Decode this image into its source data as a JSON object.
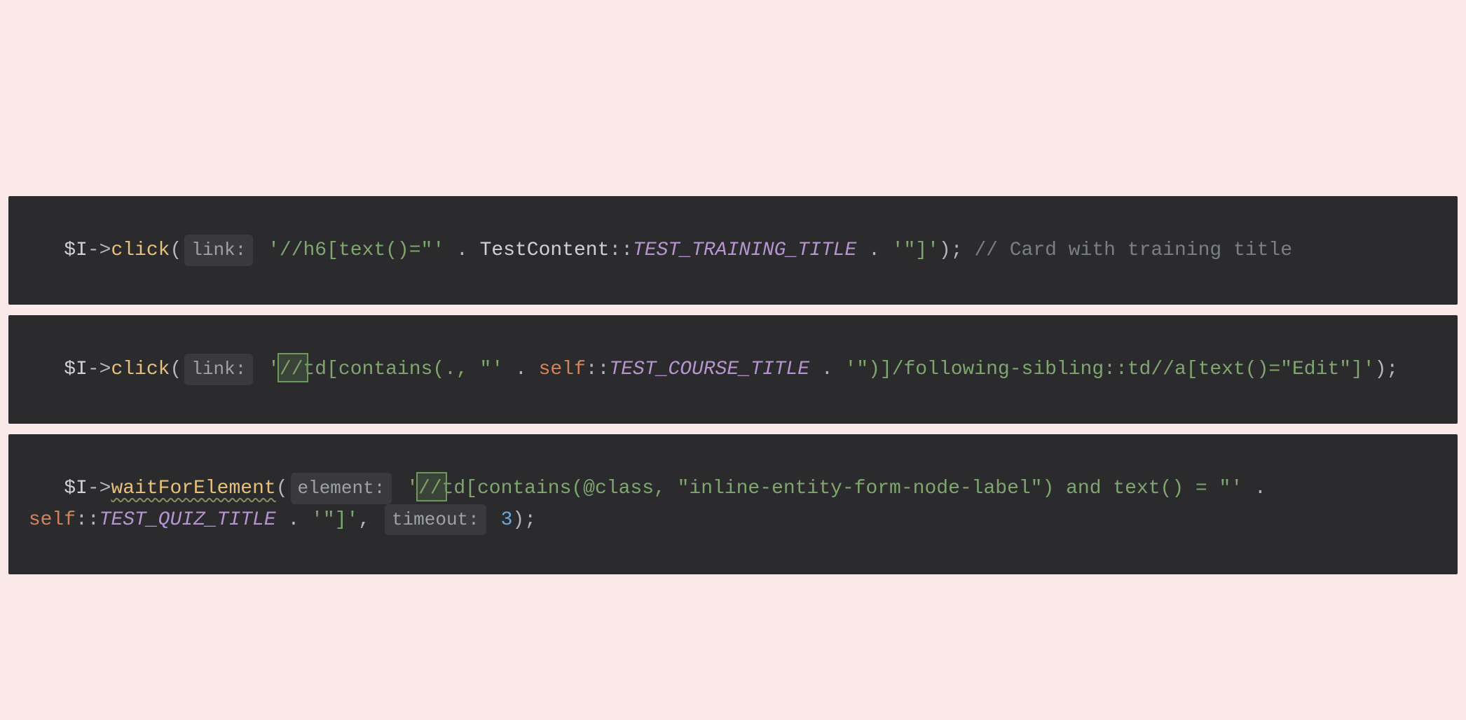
{
  "snippet1": {
    "var": "$I",
    "arrow": "->",
    "func": "click",
    "hint_label": "link:",
    "str_part1": "'//h6[text()=\"'",
    "concat": " . ",
    "class_name": "TestContent",
    "scope": "::",
    "const_name": "TEST_TRAINING_TITLE",
    "concat2": " . ",
    "str_part2": "'\"]'",
    "end": ");",
    "comment": " // Card with training title"
  },
  "snippet2": {
    "var": "$I",
    "arrow": "->",
    "func": "click",
    "hint_label": "link:",
    "str_part1": "'//td[contains(., \"'",
    "concat": " . ",
    "kw": "self",
    "scope": "::",
    "const_name": "TEST_COURSE_TITLE",
    "concat2": " . ",
    "str_part2": "'\")]/following-sibling::td//a[text()=\"Edit\"]'",
    "end": ");"
  },
  "snippet3": {
    "var": "$I",
    "arrow": "->",
    "func": "waitForElement",
    "hint_label1": "element:",
    "str_part1": "'//td[contains(@class, \"inline-entity-form-node-label\") and text() = \"'",
    "concat": " . ",
    "kw": "self",
    "scope": "::",
    "const_name": "TEST_QUIZ_TITLE",
    "concat2": " . ",
    "str_part2": "'\"]'",
    "comma": ", ",
    "hint_label2": "timeout:",
    "num": "3",
    "end": ");",
    "indent": " "
  }
}
